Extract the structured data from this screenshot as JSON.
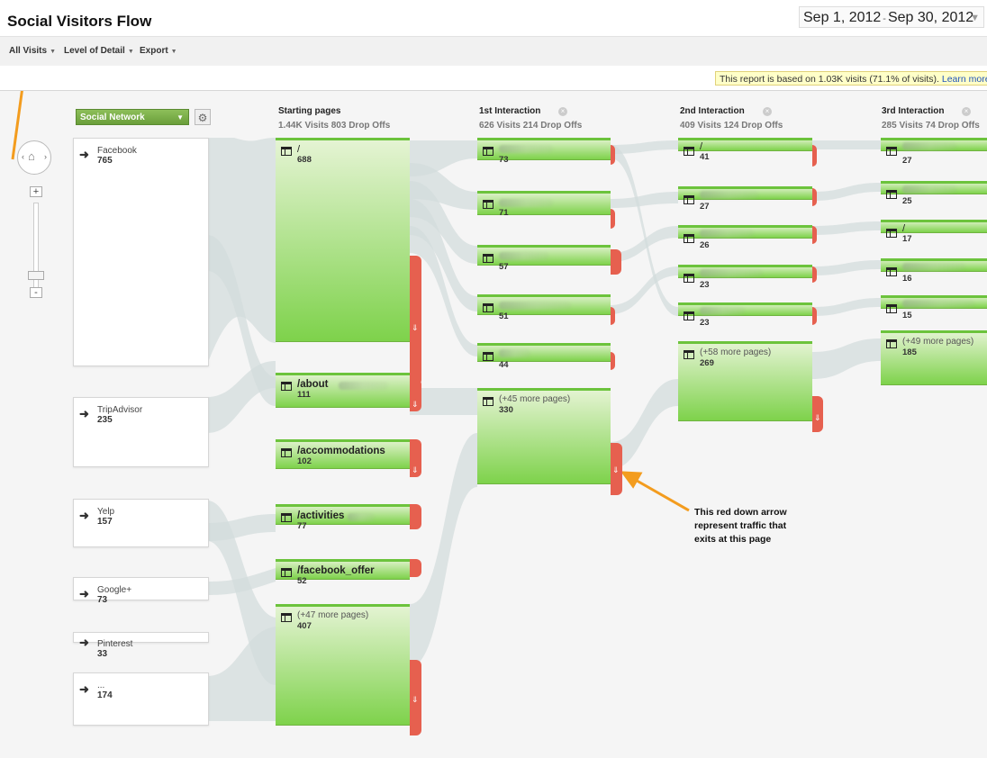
{
  "header": {
    "title": "Social Visitors Flow",
    "date_start": "Sep 1, 2012",
    "date_sep": "-",
    "date_end": "Sep 30, 2012"
  },
  "toolbar": {
    "all_visits": "All Visits",
    "level_of_detail": "Level of Detail",
    "export": "Export"
  },
  "notice": {
    "text": "This report is based on 1.03K visits (71.1% of visits).",
    "link": "Learn more"
  },
  "dimension": {
    "selected": "Social Network"
  },
  "columns": [
    {
      "title": "Starting pages",
      "stats": "1.44K Visits 803 Drop Offs"
    },
    {
      "title": "1st Interaction",
      "stats": "626 Visits 214 Drop Offs"
    },
    {
      "title": "2nd Interaction",
      "stats": "409 Visits 124 Drop Offs"
    },
    {
      "title": "3rd Interaction",
      "stats": "285 Visits 74 Drop Offs"
    }
  ],
  "sources": [
    {
      "name": "Facebook",
      "count": "765"
    },
    {
      "name": "TripAdvisor",
      "count": "235"
    },
    {
      "name": "Yelp",
      "count": "157"
    },
    {
      "name": "Google+",
      "count": "73"
    },
    {
      "name": "Pinterest",
      "count": "33"
    },
    {
      "name": "...",
      "count": "174"
    }
  ],
  "starting_pages": [
    {
      "label": "/",
      "count": "688"
    },
    {
      "label": "/about",
      "count": "111"
    },
    {
      "label": "/accommodations",
      "count": "102"
    },
    {
      "label": "/activities",
      "count": "77"
    },
    {
      "label": "/facebook_offer",
      "count": "52"
    },
    {
      "label": "(+47 more pages)",
      "count": "407"
    }
  ],
  "first_interaction": [
    {
      "label": "",
      "count": "73"
    },
    {
      "label": "",
      "count": "71"
    },
    {
      "label": "",
      "count": "57"
    },
    {
      "label": "",
      "count": "51"
    },
    {
      "label": "",
      "count": "44"
    },
    {
      "label": "(+45 more pages)",
      "count": "330"
    }
  ],
  "second_interaction": [
    {
      "label": "/",
      "count": "41"
    },
    {
      "label": "",
      "count": "27"
    },
    {
      "label": "",
      "count": "26"
    },
    {
      "label": "",
      "count": "23"
    },
    {
      "label": "",
      "count": "23"
    },
    {
      "label": "(+58 more pages)",
      "count": "269"
    }
  ],
  "third_interaction": [
    {
      "label": "",
      "count": "27"
    },
    {
      "label": "",
      "count": "25"
    },
    {
      "label": "/",
      "count": "17"
    },
    {
      "label": "",
      "count": "16"
    },
    {
      "label": "",
      "count": "15"
    },
    {
      "label": "(+49 more pages)",
      "count": "185"
    }
  ],
  "annotation": {
    "line1": "This red down arrow",
    "line2": "represent traffic that",
    "line3": "exits at this page"
  },
  "colors": {
    "accent_orange": "#f39c1e",
    "node_green": "#7ed24b",
    "dropoff_red": "#e6604f",
    "flow_gray": "#d3dcdc"
  }
}
